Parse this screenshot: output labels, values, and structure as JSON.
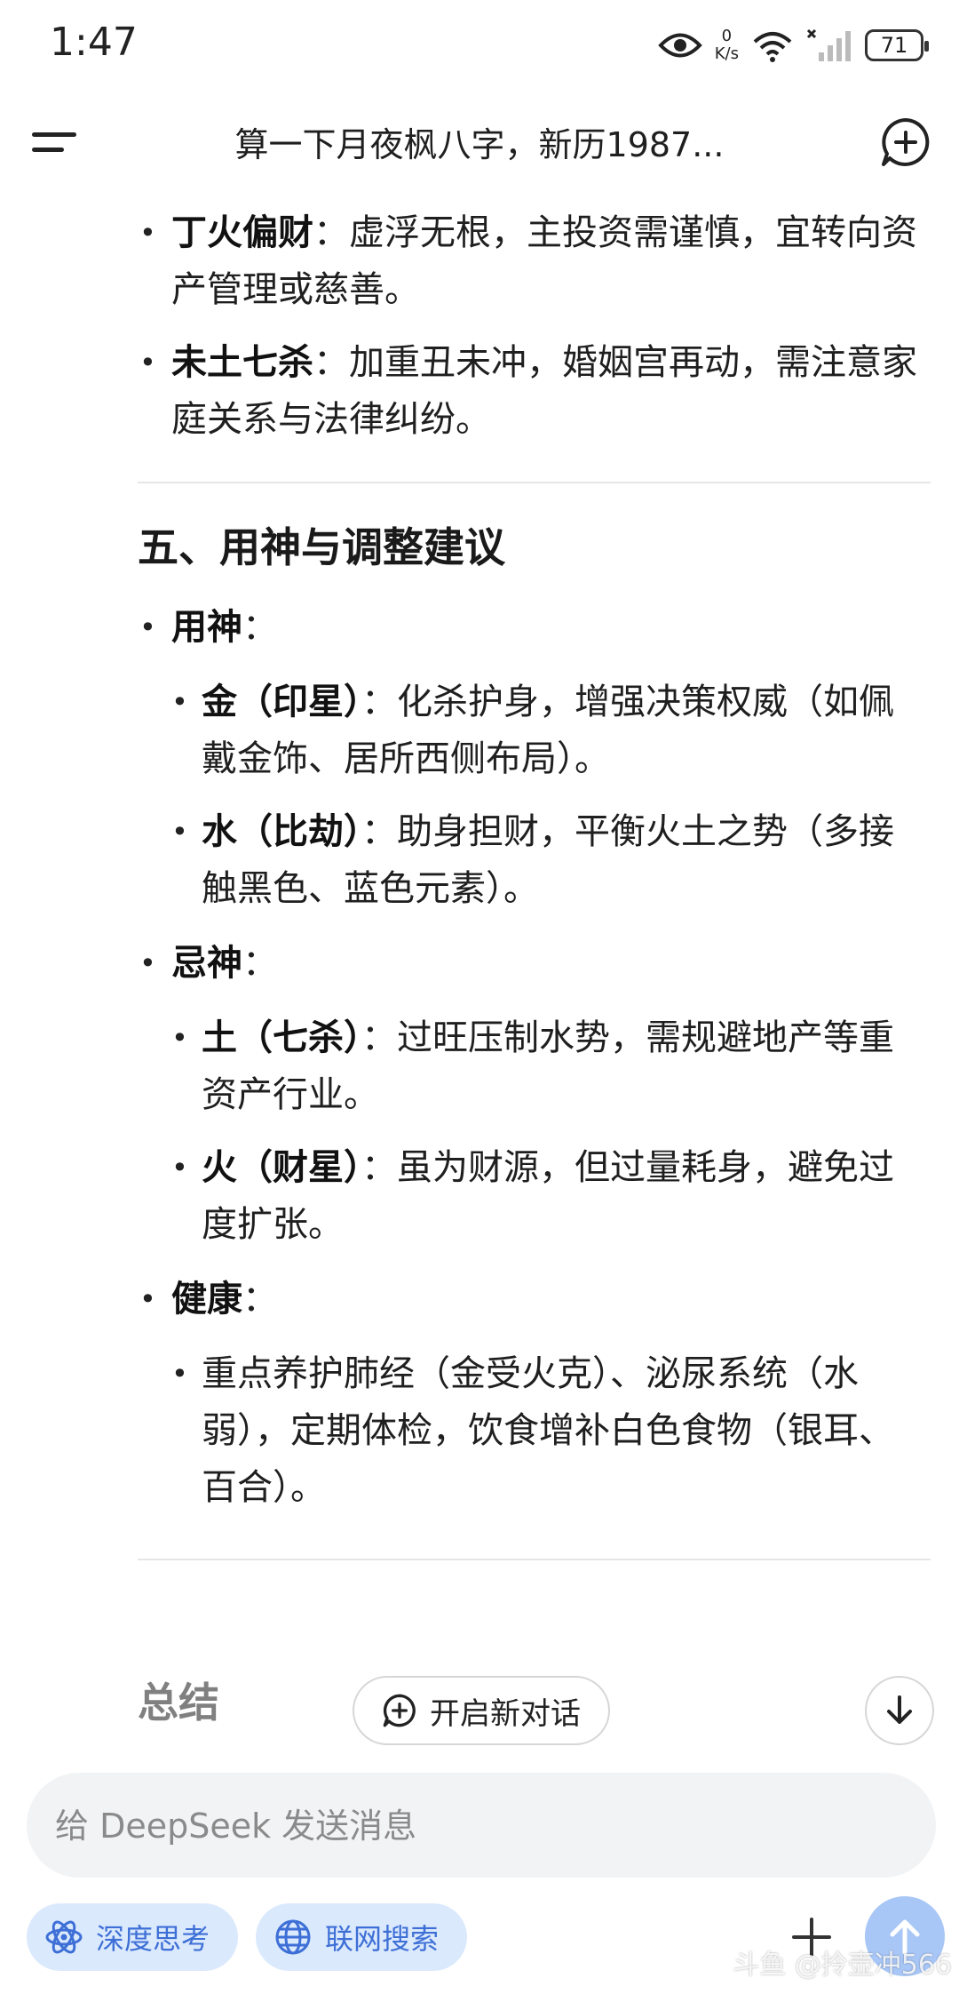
{
  "status_bar": {
    "time": "1:47",
    "net_speed_value": "0",
    "net_speed_unit": "K/s",
    "battery": "71"
  },
  "header": {
    "title": "算一下月夜枫八字，新历1987..."
  },
  "content": {
    "top_items": [
      {
        "bold": "丁火偏财",
        "text": "：虚浮无根，主投资需谨慎，宜转向资产管理或慈善。"
      },
      {
        "bold": "未土七杀",
        "text": "：加重丑未冲，婚姻宫再动，需注意家庭关系与法律纠纷。"
      }
    ],
    "section_title": "五、用神与调整建议",
    "groups": [
      {
        "bold": "用神",
        "text": "：",
        "items": [
          {
            "bold": "金（印星）",
            "text": "：化杀护身，增强决策权威（如佩戴金饰、居所西侧布局）。"
          },
          {
            "bold": "水（比劫）",
            "text": "：助身担财，平衡火土之势（多接触黑色、蓝色元素）。"
          }
        ]
      },
      {
        "bold": "忌神",
        "text": "：",
        "items": [
          {
            "bold": "土（七杀）",
            "text": "：过旺压制水势，需规避地产等重资产行业。"
          },
          {
            "bold": "火（财星）",
            "text": "：虽为财源，但过量耗身，避免过度扩张。"
          }
        ]
      },
      {
        "bold": "健康",
        "text": "：",
        "items": [
          {
            "bold": "",
            "text": "重点养护肺经（金受火克）、泌尿系统（水弱），定期体检，饮食增补白色食物（银耳、百合）。"
          }
        ]
      }
    ],
    "summary_title": "总结"
  },
  "new_chat_button": "开启新对话",
  "input": {
    "placeholder": "给 DeepSeek 发送消息",
    "value": ""
  },
  "chips": {
    "deep_think": "深度思考",
    "web_search": "联网搜索"
  },
  "watermark": "斗鱼 @拎壶冲566",
  "colors": {
    "chip_bg": "#dbe9fd",
    "chip_text": "#3d6fd6",
    "send_button": "#a8c6f6"
  }
}
